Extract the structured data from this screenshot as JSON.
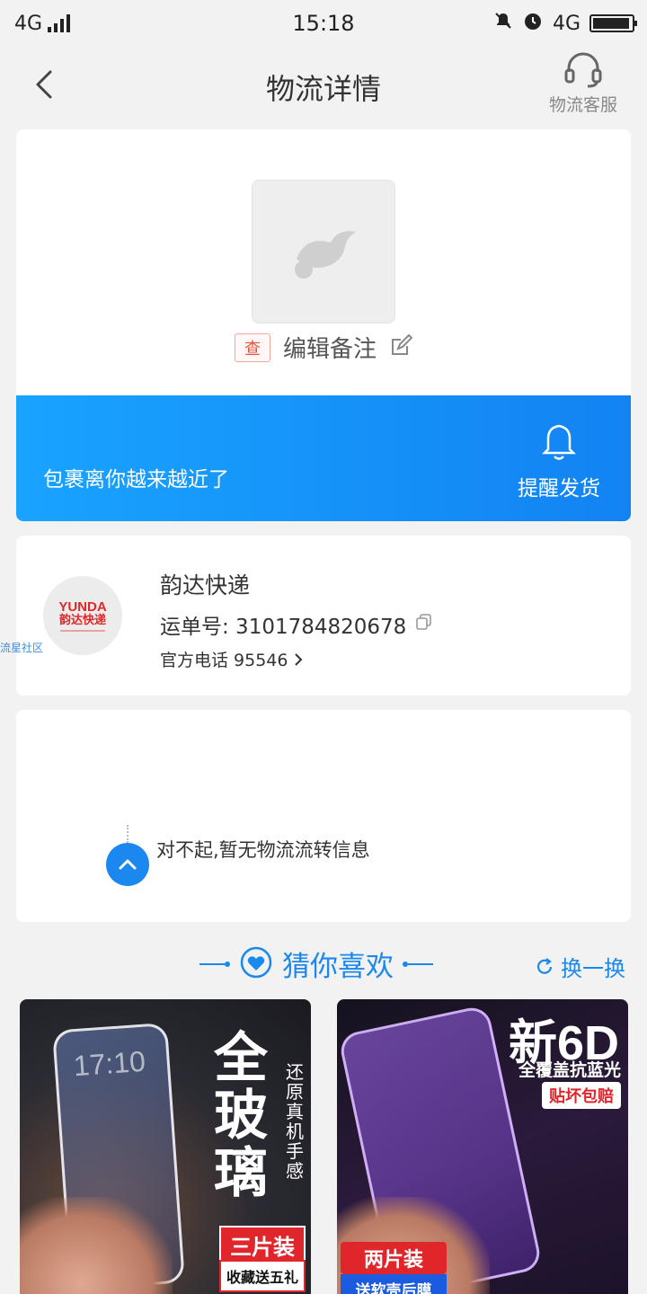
{
  "status_bar": {
    "network": "4G",
    "time": "15:18",
    "network_right": "4G"
  },
  "header": {
    "title": "物流详情",
    "service_label": "物流客服"
  },
  "package": {
    "tag": "查",
    "edit_note_label": "编辑备注"
  },
  "banner": {
    "message": "包裹离你越来越近了",
    "remind_label": "提醒发货"
  },
  "courier": {
    "logo_en": "YUNDA",
    "logo_cn": "韵达快递",
    "name": "韵达快递",
    "waybill_label": "运单号: 3101784820678",
    "phone_label": "官方电话 95546",
    "side_tag": "流星社区"
  },
  "tracking": {
    "message": "对不起,暂无物流流转信息"
  },
  "recommend": {
    "title": "猜你喜欢",
    "refresh_label": "换一换",
    "products": [
      {
        "big_text": "全玻璃",
        "side_text": "还原真机手感",
        "badge": "三片装",
        "sub_badge": "收藏送五礼",
        "clock": "17:10"
      },
      {
        "big_text": "新6D",
        "sub_text": "全覆盖抗蓝光",
        "badge_top": "贴坏包赔",
        "badge": "两片装",
        "sub_badge": "送软壳后膜"
      }
    ]
  },
  "colors": {
    "accent": "#1b88f0",
    "banner_start": "#19a3ff",
    "banner_end": "#1283f3",
    "tag_red": "#e5533c"
  }
}
